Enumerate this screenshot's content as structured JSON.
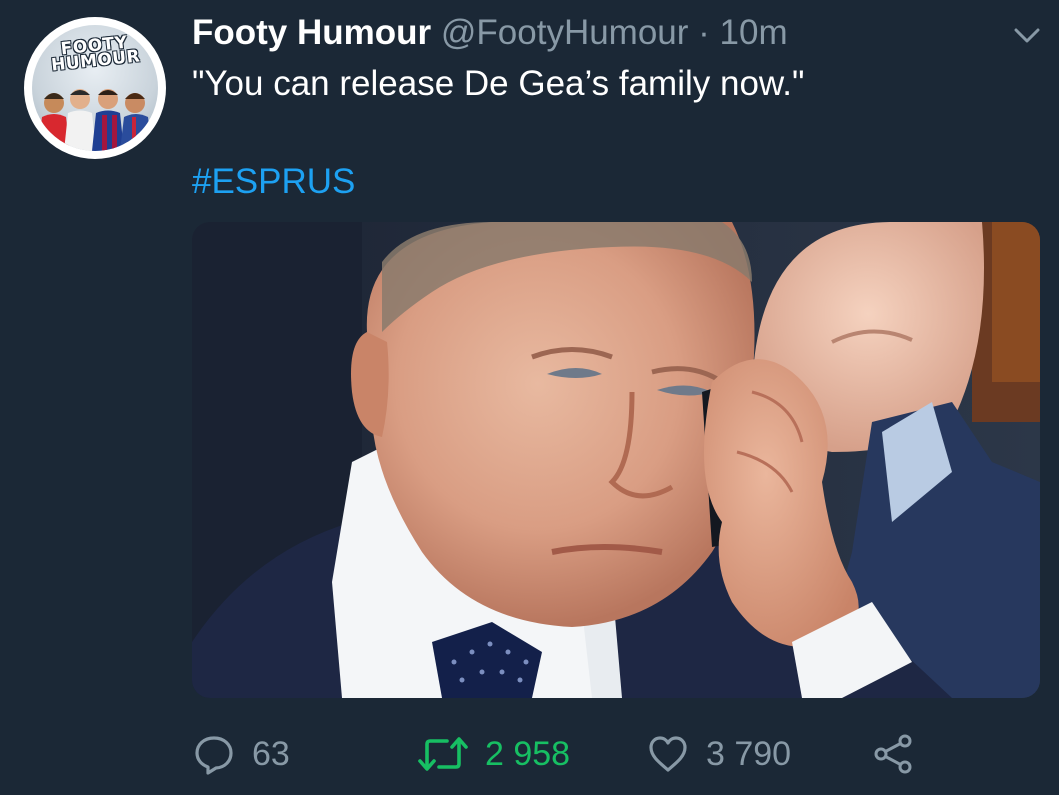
{
  "tweet": {
    "author_name": "Footy Humour",
    "author_handle": "@FootyHumour",
    "separator": "·",
    "time": "10m",
    "text": "\"You can release De Gea’s family now.\"",
    "hashtag": "#ESPRUS",
    "avatar_logo_line1": "FOOTY",
    "avatar_logo_line2": "HUMOUR"
  },
  "actions": {
    "reply_icon": "reply-bubble-icon",
    "reply_count": "63",
    "retweet_icon": "retweet-icon",
    "retweet_count": "2 958",
    "like_icon": "heart-icon",
    "like_count": "3 790",
    "share_icon": "share-icon"
  },
  "colors": {
    "background": "#1b2836",
    "text_primary": "#ffffff",
    "text_secondary": "#8899a6",
    "link": "#1da1f2",
    "retweet_active": "#17bf63"
  }
}
